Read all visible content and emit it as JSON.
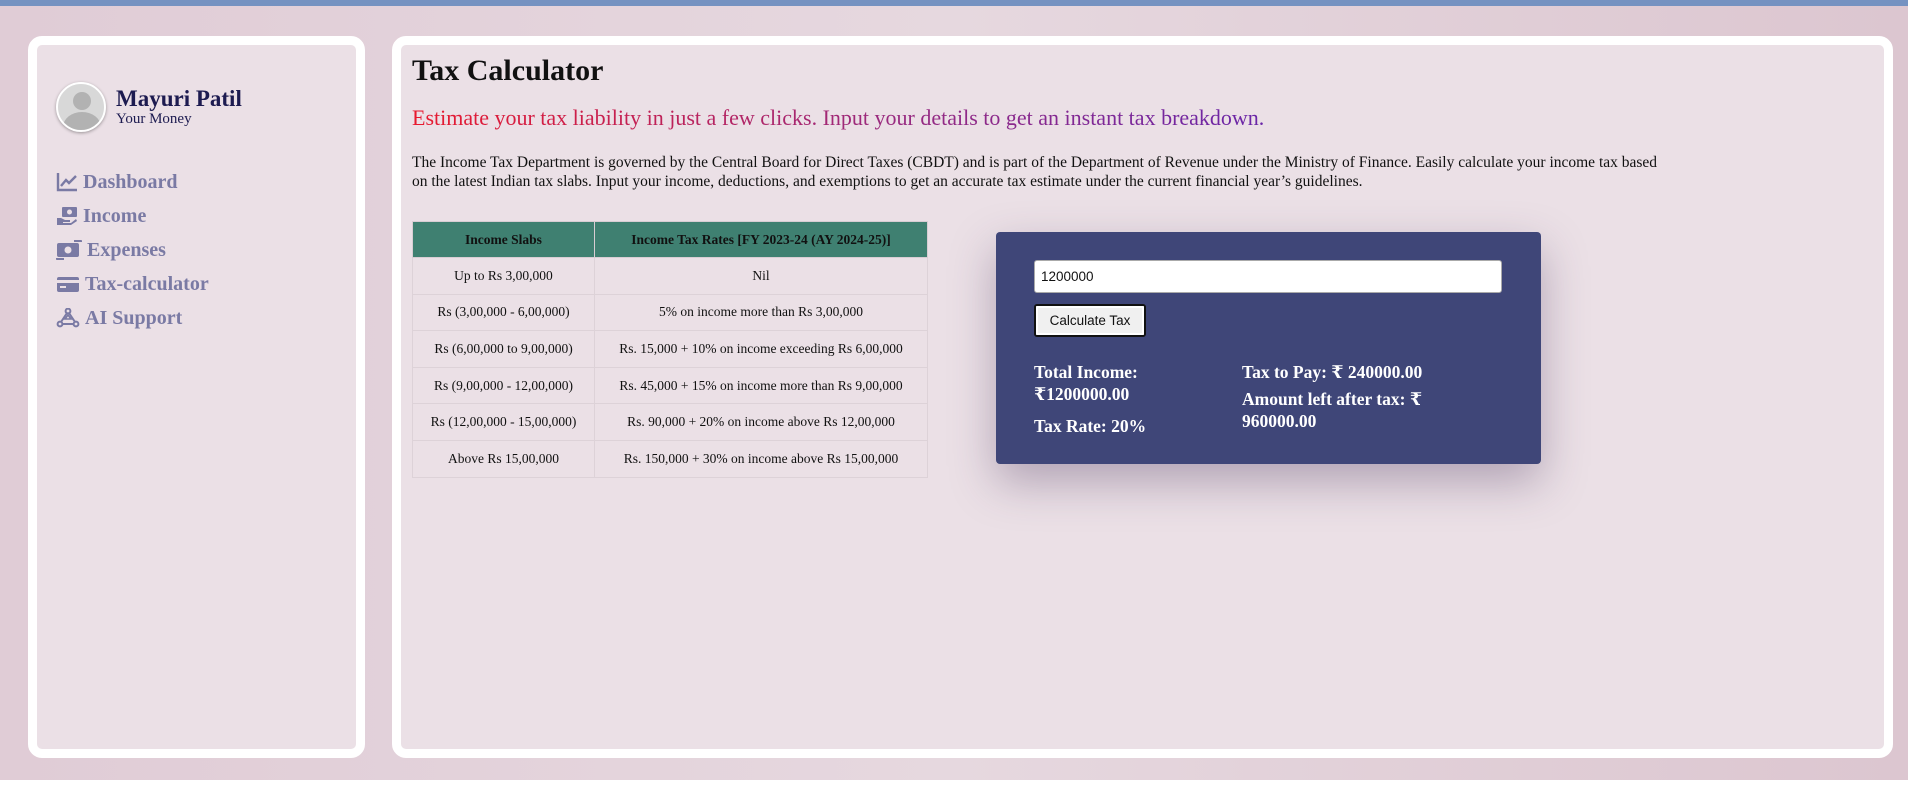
{
  "profile": {
    "name": "Mayuri Patil",
    "subtitle": "Your Money",
    "avatar_icon": "user-avatar-icon"
  },
  "sidebar": {
    "items": [
      {
        "label": "Dashboard",
        "icon": "line-chart-icon"
      },
      {
        "label": "Income",
        "icon": "money-hand-icon"
      },
      {
        "label": "Expenses",
        "icon": "money-transfer-icon"
      },
      {
        "label": "Tax-calculator",
        "icon": "credit-card-icon"
      },
      {
        "label": "AI Support",
        "icon": "ai-network-icon"
      }
    ]
  },
  "main": {
    "title": "Tax Calculator",
    "tagline": "Estimate your tax liability in just a few clicks. Input your details to get an instant tax breakdown.",
    "description": "The Income Tax Department is governed by the Central Board for Direct Taxes (CBDT) and is part of the Department of Revenue under the Ministry of Finance. Easily calculate your income tax based on the latest Indian tax slabs. Input your income, deductions, and exemptions to get an accurate tax estimate under the current financial year’s guidelines."
  },
  "table": {
    "headers": [
      "Income Slabs",
      "Income Tax Rates  [FY 2023-24 (AY 2024-25)]"
    ],
    "rows": [
      [
        "Up to Rs 3,00,000",
        "Nil"
      ],
      [
        "Rs (3,00,000 - 6,00,000)",
        "5% on income more than Rs 3,00,000"
      ],
      [
        "Rs (6,00,000 to 9,00,000)",
        "Rs. 15,000 + 10% on income exceeding Rs 6,00,000"
      ],
      [
        "Rs (9,00,000 - 12,00,000)",
        "Rs. 45,000 + 15% on income more than Rs 9,00,000"
      ],
      [
        "Rs (12,00,000 - 15,00,000)",
        "Rs. 90,000 + 20% on income above Rs 12,00,000"
      ],
      [
        "Above Rs 15,00,000",
        "Rs. 150,000 + 30% on income above Rs 15,00,000"
      ]
    ]
  },
  "calculator": {
    "input_value": "1200000",
    "button_label": "Calculate Tax",
    "total_income": "Total Income: ₹1200000.00",
    "tax_rate": "Tax Rate: 20%",
    "tax_to_pay": "Tax to Pay: ₹ 240000.00",
    "amount_left": "Amount left after tax: ₹ 960000.00"
  },
  "colors": {
    "nav_text": "#7a7aa4",
    "table_header": "#3f8071",
    "calculator_bg": "#3f4678",
    "name_text": "#1d1b50",
    "topbar": "#7592c1"
  }
}
